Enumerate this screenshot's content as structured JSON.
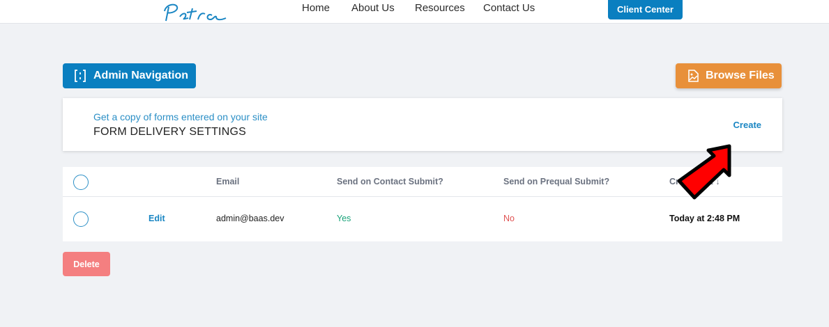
{
  "header": {
    "logo_text": "Petra",
    "nav": [
      "Home",
      "About Us",
      "Resources",
      "Contact Us"
    ],
    "client_center": "Client Center"
  },
  "toolbar": {
    "admin_navigation": "Admin Navigation",
    "browse_files": "Browse Files"
  },
  "card": {
    "subtitle": "Get a copy of forms entered on your site",
    "title": "FORM DELIVERY SETTINGS",
    "create": "Create"
  },
  "table": {
    "columns": {
      "email": "Email",
      "contact_submit": "Send on Contact Submit?",
      "prequal_submit": "Send on Prequal Submit?",
      "created_at": "Created At",
      "sort_icon": "↓"
    },
    "rows": [
      {
        "edit": "Edit",
        "email": "admin@baas.dev",
        "contact_submit": "Yes",
        "prequal_submit": "No",
        "created_at": "Today at 2:48 PM"
      }
    ]
  },
  "actions": {
    "delete": "Delete"
  },
  "colors": {
    "primary": "#0a7fc0",
    "orange": "#e8903a",
    "yes_green": "#1aa37a",
    "no_red": "#e05252",
    "delete_pink": "#f47f80",
    "arrow_red": "#ff0000"
  },
  "icons": {
    "admin_nav": "panel-brackets-icon",
    "browse": "image-file-icon",
    "annotation": "red-arrow-icon"
  }
}
